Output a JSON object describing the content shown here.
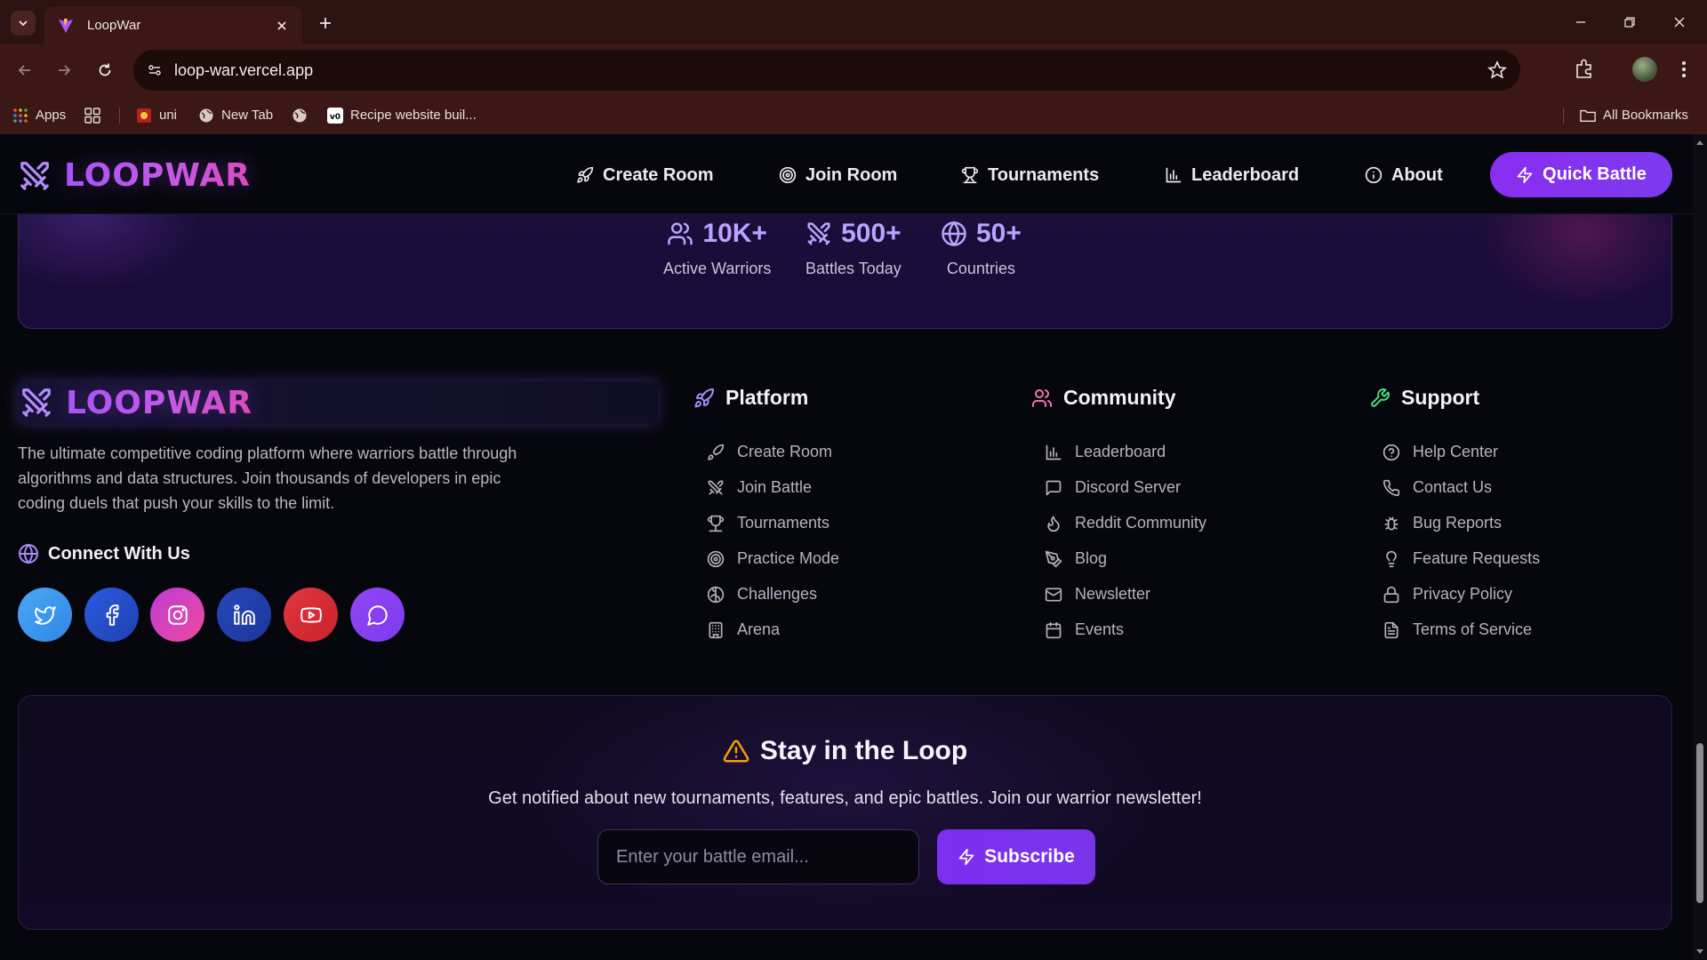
{
  "browser": {
    "tab_title": "LoopWar",
    "url": "loop-war.vercel.app",
    "bookmarks": [
      {
        "label": "Apps"
      },
      {
        "label": ""
      },
      {
        "label": "uni"
      },
      {
        "label": "New Tab"
      },
      {
        "label": ""
      },
      {
        "label": "Recipe website buil..."
      }
    ],
    "all_bookmarks": "All Bookmarks"
  },
  "nav": {
    "brand": "LOOPWAR",
    "links": [
      {
        "label": "Create Room",
        "icon": "rocket-icon"
      },
      {
        "label": "Join Room",
        "icon": "target-icon"
      },
      {
        "label": "Tournaments",
        "icon": "trophy-icon"
      },
      {
        "label": "Leaderboard",
        "icon": "bar-chart-icon"
      },
      {
        "label": "About",
        "icon": "info-icon"
      }
    ],
    "cta": "Quick Battle"
  },
  "stats": [
    {
      "value": "10K+",
      "label": "Active Warriors",
      "icon": "users-icon"
    },
    {
      "value": "500+",
      "label": "Battles Today",
      "icon": "swords-icon"
    },
    {
      "value": "50+",
      "label": "Countries",
      "icon": "globe-icon"
    }
  ],
  "footer": {
    "brand": "LOOPWAR",
    "description": "The ultimate competitive coding platform where warriors battle through algorithms and data structures. Join thousands of developers in epic coding duels that push your skills to the limit.",
    "connect_title": "Connect With Us",
    "social": [
      {
        "name": "twitter-icon",
        "color": "#3b9cf0"
      },
      {
        "name": "facebook-icon",
        "color": "#2450c8"
      },
      {
        "name": "instagram-icon",
        "color": "#d040b0"
      },
      {
        "name": "linkedin-icon",
        "color": "#1e3fae"
      },
      {
        "name": "youtube-icon",
        "color": "#dc2f3a"
      },
      {
        "name": "chat-icon",
        "color": "#8b3df2"
      }
    ],
    "columns": [
      {
        "title": "Platform",
        "icon": "rocket-icon",
        "color": "#a78bfa",
        "items": [
          "Create Room",
          "Join Battle",
          "Tournaments",
          "Practice Mode",
          "Challenges",
          "Arena"
        ]
      },
      {
        "title": "Community",
        "icon": "users-icon",
        "color": "#f472b6",
        "items": [
          "Leaderboard",
          "Discord Server",
          "Reddit Community",
          "Blog",
          "Newsletter",
          "Events"
        ]
      },
      {
        "title": "Support",
        "icon": "wrench-icon",
        "color": "#4ade80",
        "items": [
          "Help Center",
          "Contact Us",
          "Bug Reports",
          "Feature Requests",
          "Privacy Policy",
          "Terms of Service"
        ]
      }
    ]
  },
  "newsletter": {
    "title": "Stay in the Loop",
    "subtitle": "Get notified about new tournaments, features, and epic battles. Join our warrior newsletter!",
    "placeholder": "Enter your battle email...",
    "button": "Subscribe"
  },
  "colors": {
    "accent": "#7c3aed",
    "brand_gradient_start": "#a855f7",
    "brand_gradient_end": "#e14bb8",
    "warning": "#f59e0b"
  }
}
